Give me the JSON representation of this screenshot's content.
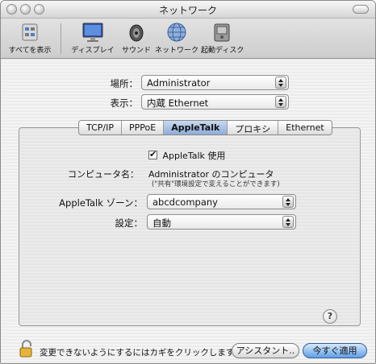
{
  "window": {
    "title": "ネットワーク"
  },
  "toolbar": {
    "items": [
      {
        "label": "すべてを表示",
        "icon": "show-all-icon"
      },
      {
        "label": "ディスプレイ",
        "icon": "display-icon"
      },
      {
        "label": "サウンド",
        "icon": "sound-icon"
      },
      {
        "label": "ネットワーク",
        "icon": "network-icon"
      },
      {
        "label": "起動ディスク",
        "icon": "startup-disk-icon"
      }
    ]
  },
  "location": {
    "label": "場所：",
    "value": "Administrator"
  },
  "show": {
    "label": "表示：",
    "value": "内蔵 Ethernet"
  },
  "tabs": [
    {
      "label": "TCP/IP",
      "active": false
    },
    {
      "label": "PPPoE",
      "active": false
    },
    {
      "label": "AppleTalk",
      "active": true
    },
    {
      "label": "プロキシ",
      "active": false
    },
    {
      "label": "Ethernet",
      "active": false
    }
  ],
  "appletalk": {
    "enable_label": "AppleTalk 使用",
    "enabled": true,
    "computer_name_label": "コンピュータ名：",
    "computer_name": "Administrator のコンピュータ",
    "computer_name_hint": "(\"共有\"環境設定で変えることができます)",
    "zone_label": "AppleTalk ゾーン：",
    "zone_value": "abcdcompany",
    "config_label": "設定：",
    "config_value": "自動"
  },
  "help": {
    "symbol": "?"
  },
  "footer": {
    "lock_text": "変更できないようにするにはカギをクリックします。",
    "assistant_button": "アシスタント..",
    "apply_button": "今すぐ適用"
  },
  "colors": {
    "accent": "#5f9fe5",
    "tab_active": "#8eacd8"
  }
}
